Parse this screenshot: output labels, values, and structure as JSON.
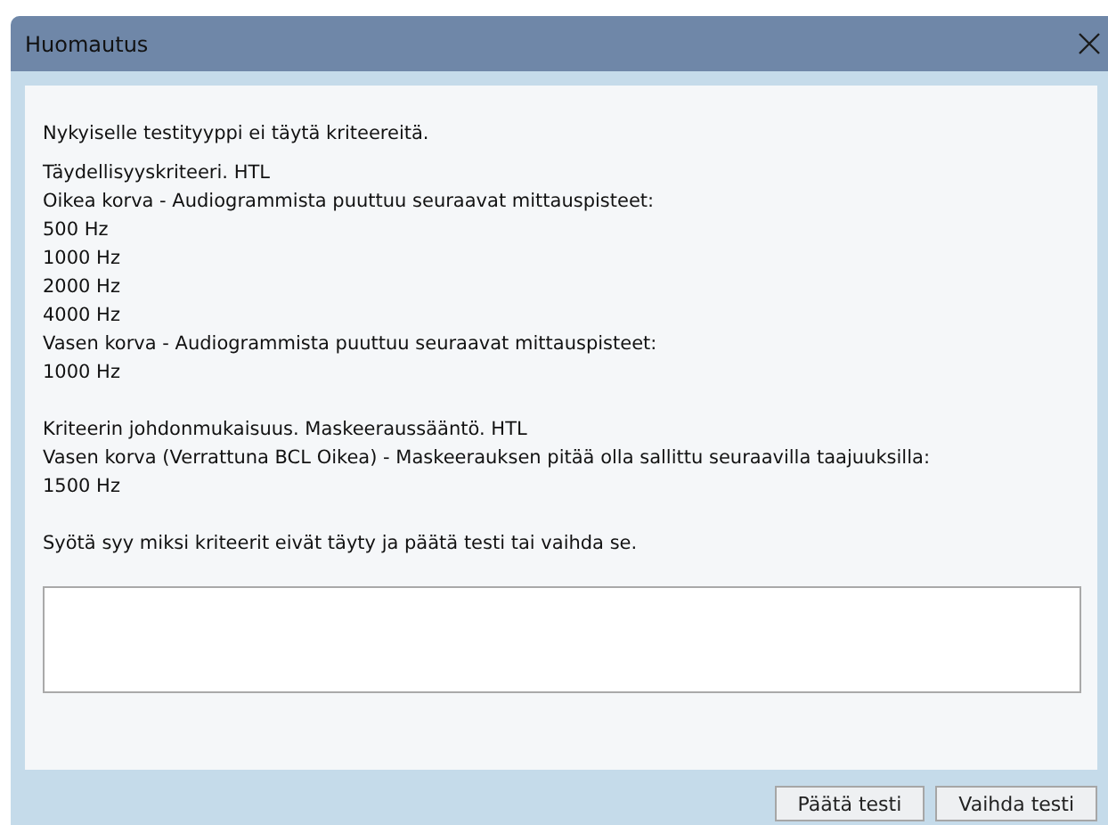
{
  "window": {
    "title": "Huomautus"
  },
  "message": {
    "paragraphs": [
      [
        "Nykyiselle testityyppi ei täytä kriteereitä."
      ],
      [
        "Täydellisyyskriteeri. HTL",
        "Oikea korva - Audiogrammista puuttuu seuraavat mittauspisteet:",
        "500 Hz",
        "1000 Hz",
        "2000 Hz",
        "4000 Hz",
        "Vasen korva - Audiogrammista puuttuu seuraavat mittauspisteet:",
        "1000 Hz"
      ],
      [
        "Kriteerin johdonmukaisuus. Maskeeraussääntö. HTL",
        "Vasen korva (Verrattuna BCL Oikea) - Maskeerauksen pitää olla sallittu seuraavilla taajuuksilla:",
        "1500 Hz"
      ],
      [
        "Syötä syy miksi kriteerit eivät täyty ja päätä testi tai vaihda se."
      ]
    ]
  },
  "buttons": [
    "Päätä testi",
    "Vaihda testi"
  ]
}
